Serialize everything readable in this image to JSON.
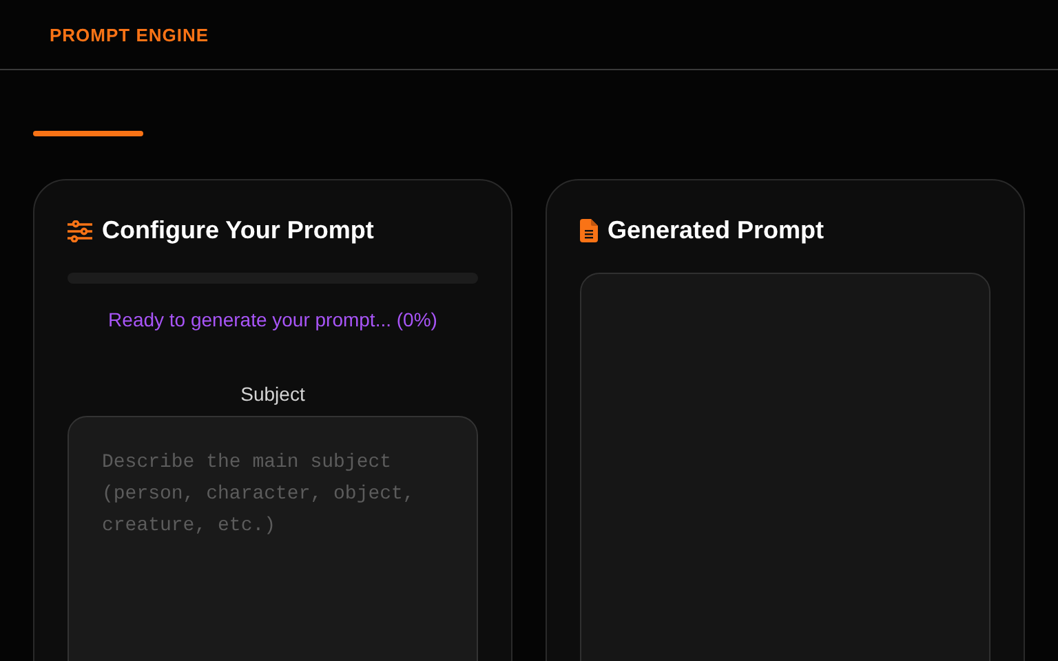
{
  "header": {
    "brand": "PROMPT ENGINE"
  },
  "config_panel": {
    "title": "Configure Your Prompt",
    "progress": {
      "level": 0
    },
    "status": "Ready to generate your prompt... (0%)",
    "fields": [
      {
        "label": "Subject",
        "placeholder": "Describe the main subject (person, character, object, creature, etc.)"
      }
    ]
  },
  "output_panel": {
    "title": "Generated Prompt"
  }
}
